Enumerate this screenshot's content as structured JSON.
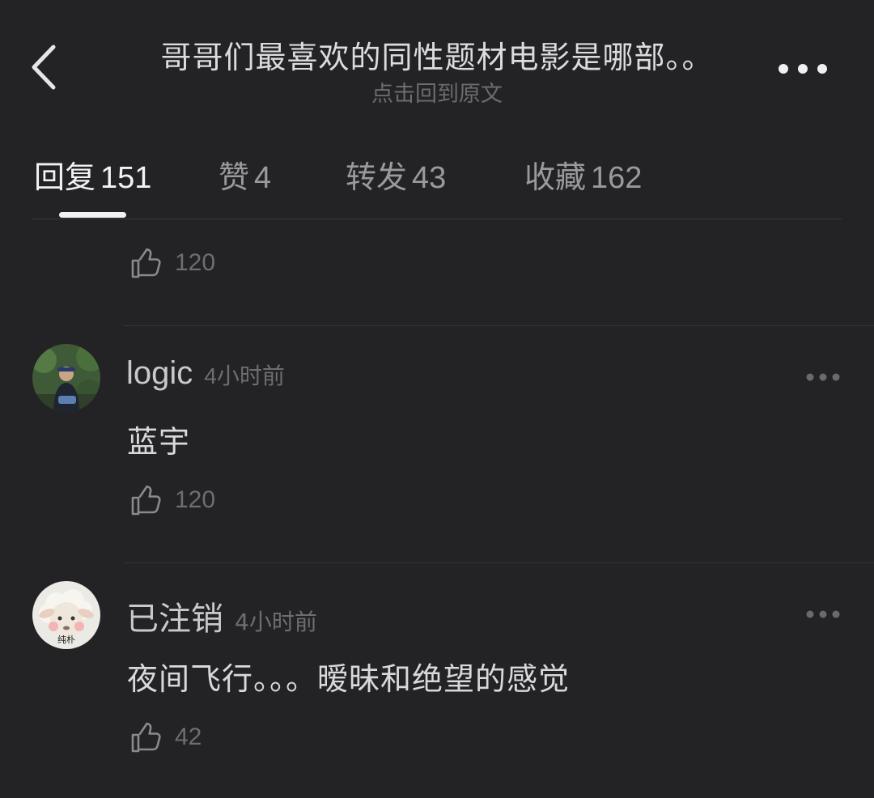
{
  "header": {
    "title": "哥哥们最喜欢的同性题材电影是哪部。。",
    "subtitle": "点击回到原文"
  },
  "tabs": [
    {
      "label": "回复",
      "count": "151",
      "active": true
    },
    {
      "label": "赞",
      "count": "4",
      "active": false
    },
    {
      "label": "转发",
      "count": "43",
      "active": false
    },
    {
      "label": "收藏",
      "count": "162",
      "active": false
    }
  ],
  "previous_comment": {
    "likes": "120"
  },
  "comments": [
    {
      "username": "logic",
      "time": "4小时前",
      "text": "蓝宇",
      "likes": "120"
    },
    {
      "username": "已注销",
      "time": "4小时前",
      "text": "夜间飞行。。。暧昧和绝望的感觉",
      "likes": "42",
      "avatar_caption": "纯朴"
    }
  ],
  "colors": {
    "background": "#232325",
    "text_primary": "#d9d9dc",
    "text_muted": "#6e6e72"
  },
  "icons": [
    "back-arrow-icon",
    "more-horizontal-icon",
    "thumbs-up-icon"
  ]
}
